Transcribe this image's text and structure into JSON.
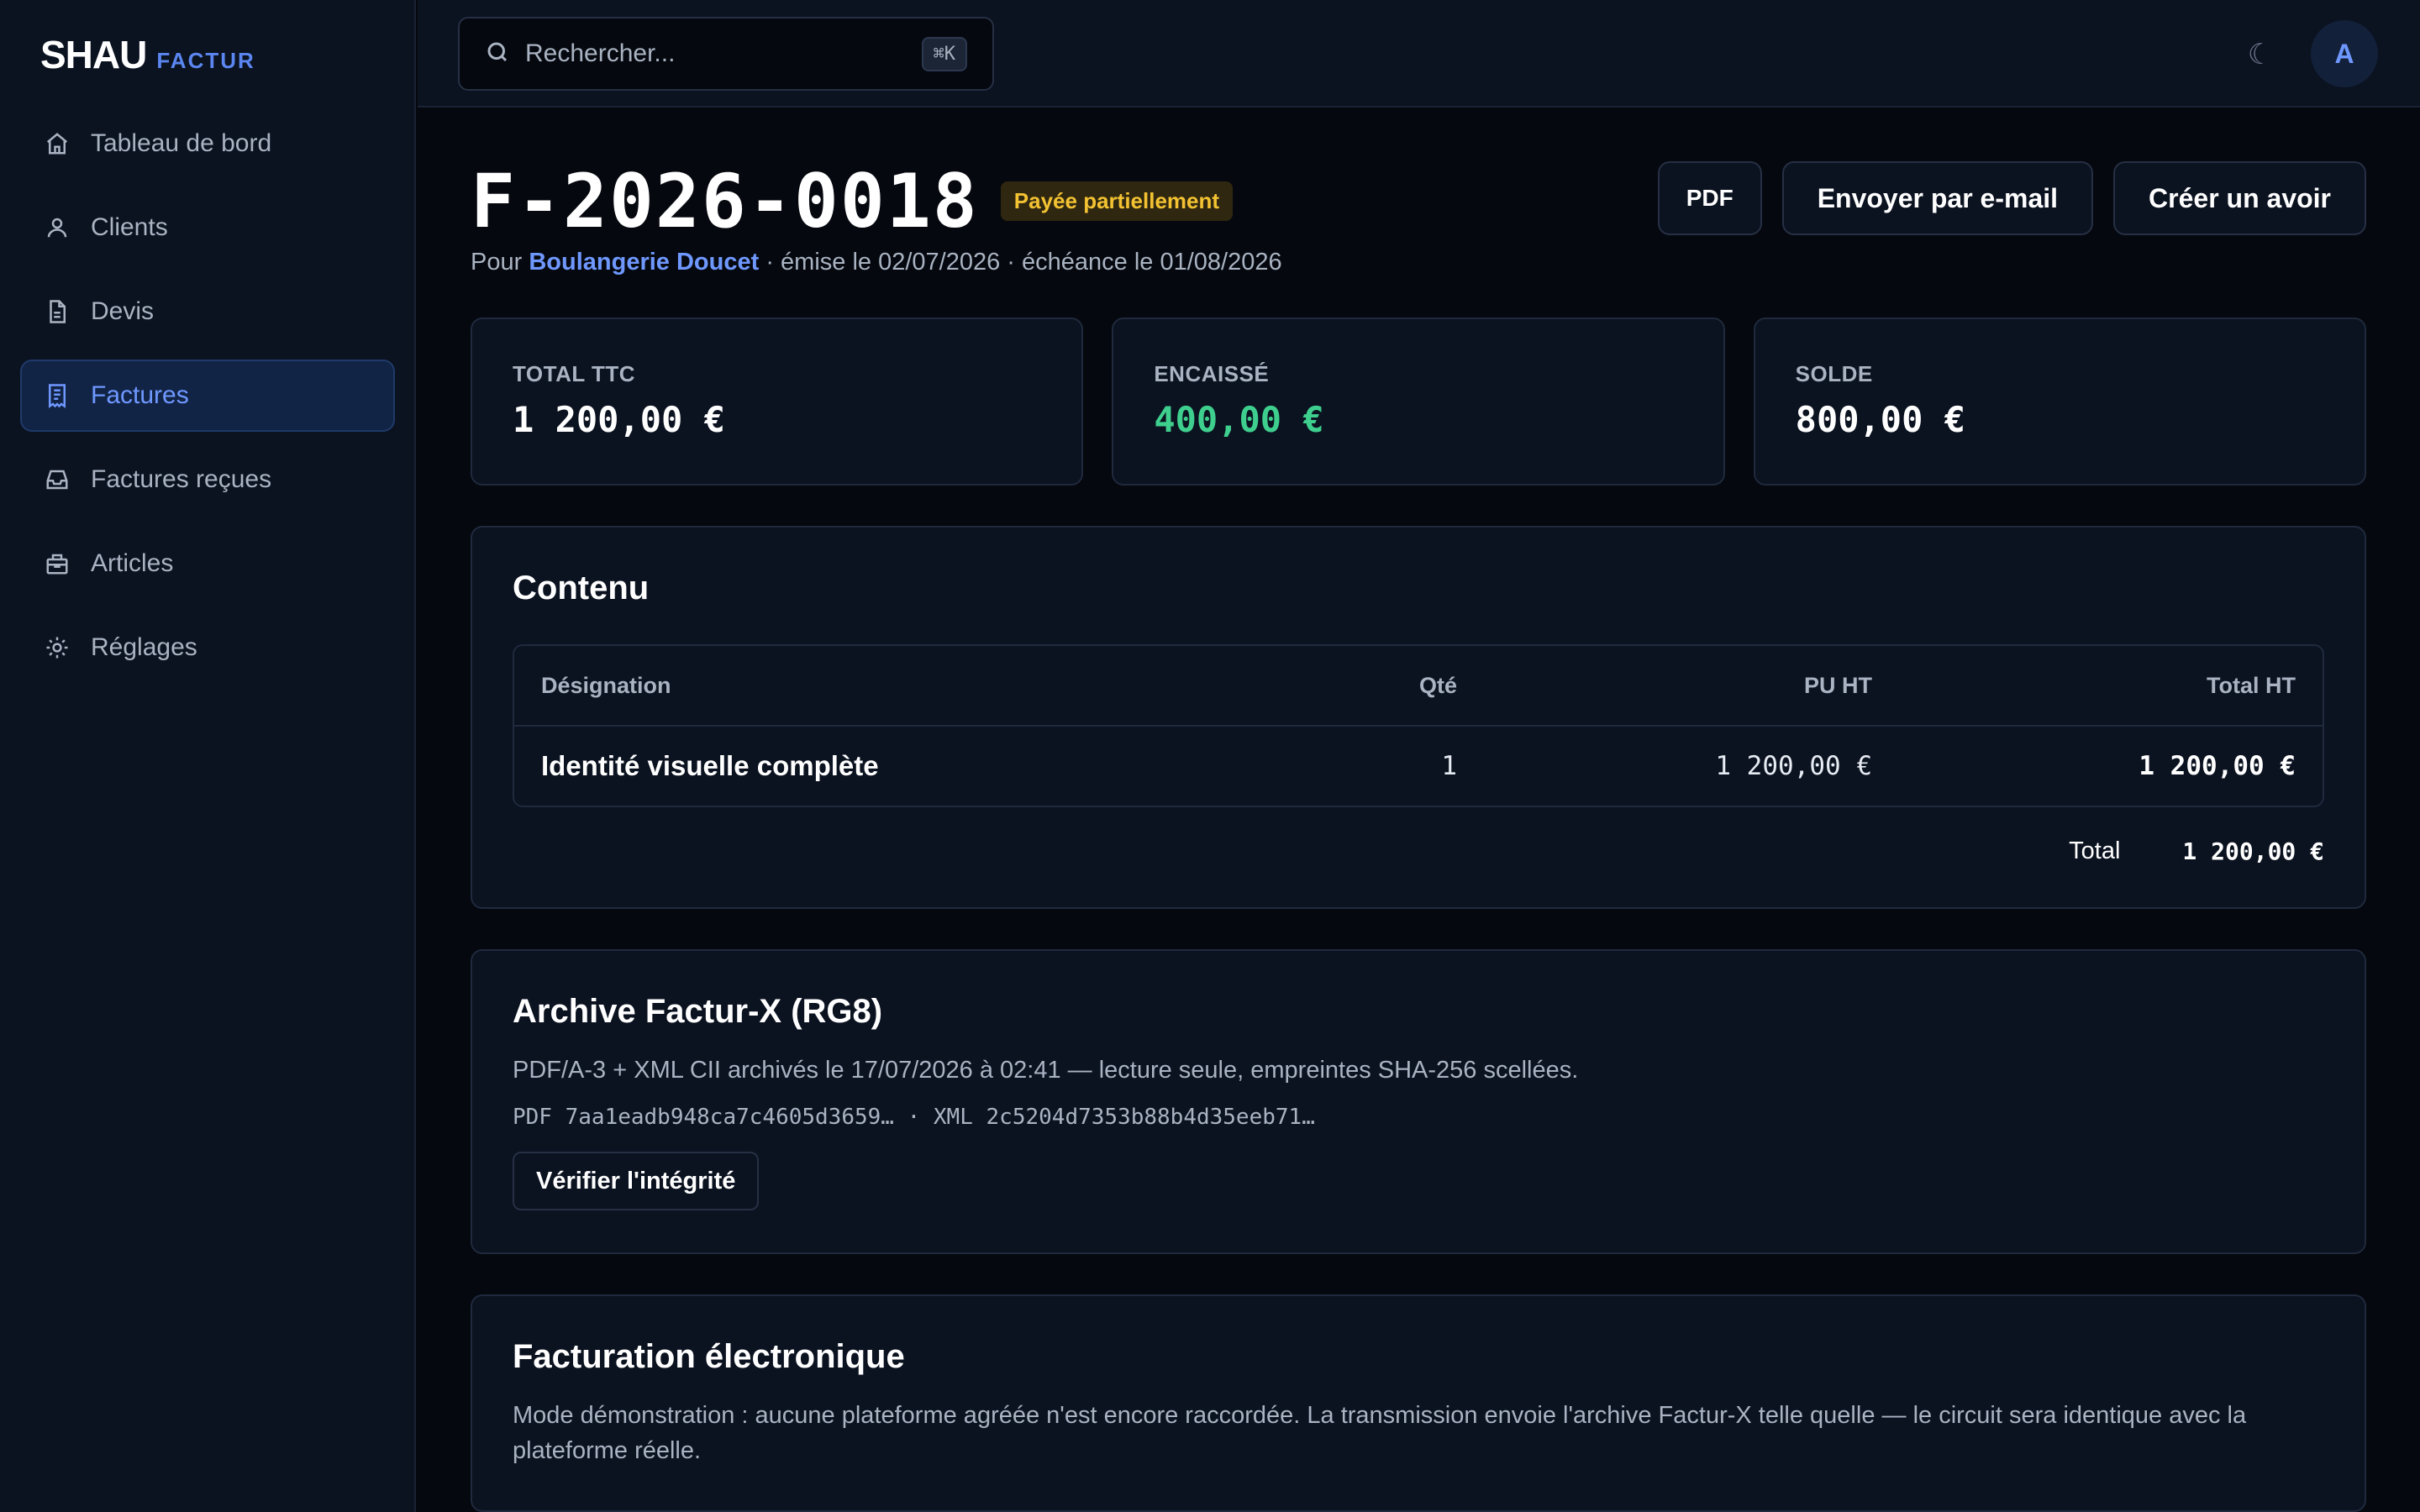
{
  "brand": {
    "main": "SHAU",
    "sub": "FACTUR"
  },
  "sidebar": {
    "items": [
      {
        "label": "Tableau de bord",
        "icon": "home-icon"
      },
      {
        "label": "Clients",
        "icon": "user-icon"
      },
      {
        "label": "Devis",
        "icon": "document-icon"
      },
      {
        "label": "Factures",
        "icon": "receipt-icon",
        "active": true
      },
      {
        "label": "Factures reçues",
        "icon": "inbox-icon"
      },
      {
        "label": "Articles",
        "icon": "box-icon"
      },
      {
        "label": "Réglages",
        "icon": "gear-icon"
      }
    ]
  },
  "topbar": {
    "search_placeholder": "Rechercher...",
    "shortcut": "⌘K",
    "theme_icon": "☾",
    "avatar_initial": "A"
  },
  "invoice": {
    "number": "F-2026-0018",
    "status": "Payée partiellement",
    "prefix": "Pour",
    "client": "Boulangerie Doucet",
    "dates": "· émise le 02/07/2026 · échéance le 01/08/2026"
  },
  "actions": {
    "pdf": "PDF",
    "email": "Envoyer par e-mail",
    "credit": "Créer un avoir"
  },
  "summary": {
    "total_label": "TOTAL TTC",
    "total_value": "1 200,00 €",
    "paid_label": "ENCAISSÉ",
    "paid_value": "400,00 €",
    "balance_label": "SOLDE",
    "balance_value": "800,00 €"
  },
  "content": {
    "title": "Contenu",
    "columns": [
      "Désignation",
      "Qté",
      "PU HT",
      "Total HT"
    ],
    "rows": [
      [
        "Identité visuelle complète",
        "1",
        "1 200,00 €",
        "1 200,00 €"
      ]
    ],
    "total_label": "Total",
    "total_value": "1 200,00 €"
  },
  "archive": {
    "title": "Archive Factur-X (RG8)",
    "description": "PDF/A-3 + XML CII archivés le 17/07/2026 à 02:41 — lecture seule, empreintes SHA-256 scellées.",
    "hashes": "PDF 7aa1eadb948ca7c4605d3659… · XML 2c5204d7353b88b4d35eeb71…",
    "verify_label": "Vérifier l'intégrité"
  },
  "einvoice": {
    "title": "Facturation électronique",
    "description": "Mode démonstration : aucune plateforme agréée n'est encore raccordée. La transmission envoie l'archive Factur-X telle quelle — le circuit sera identique avec la plateforme réelle."
  },
  "colors": {
    "accent": "#6f98ff",
    "success": "#3ecf8e",
    "warning": "#f3c232",
    "background": "#05080e",
    "surface": "#0b1220"
  }
}
